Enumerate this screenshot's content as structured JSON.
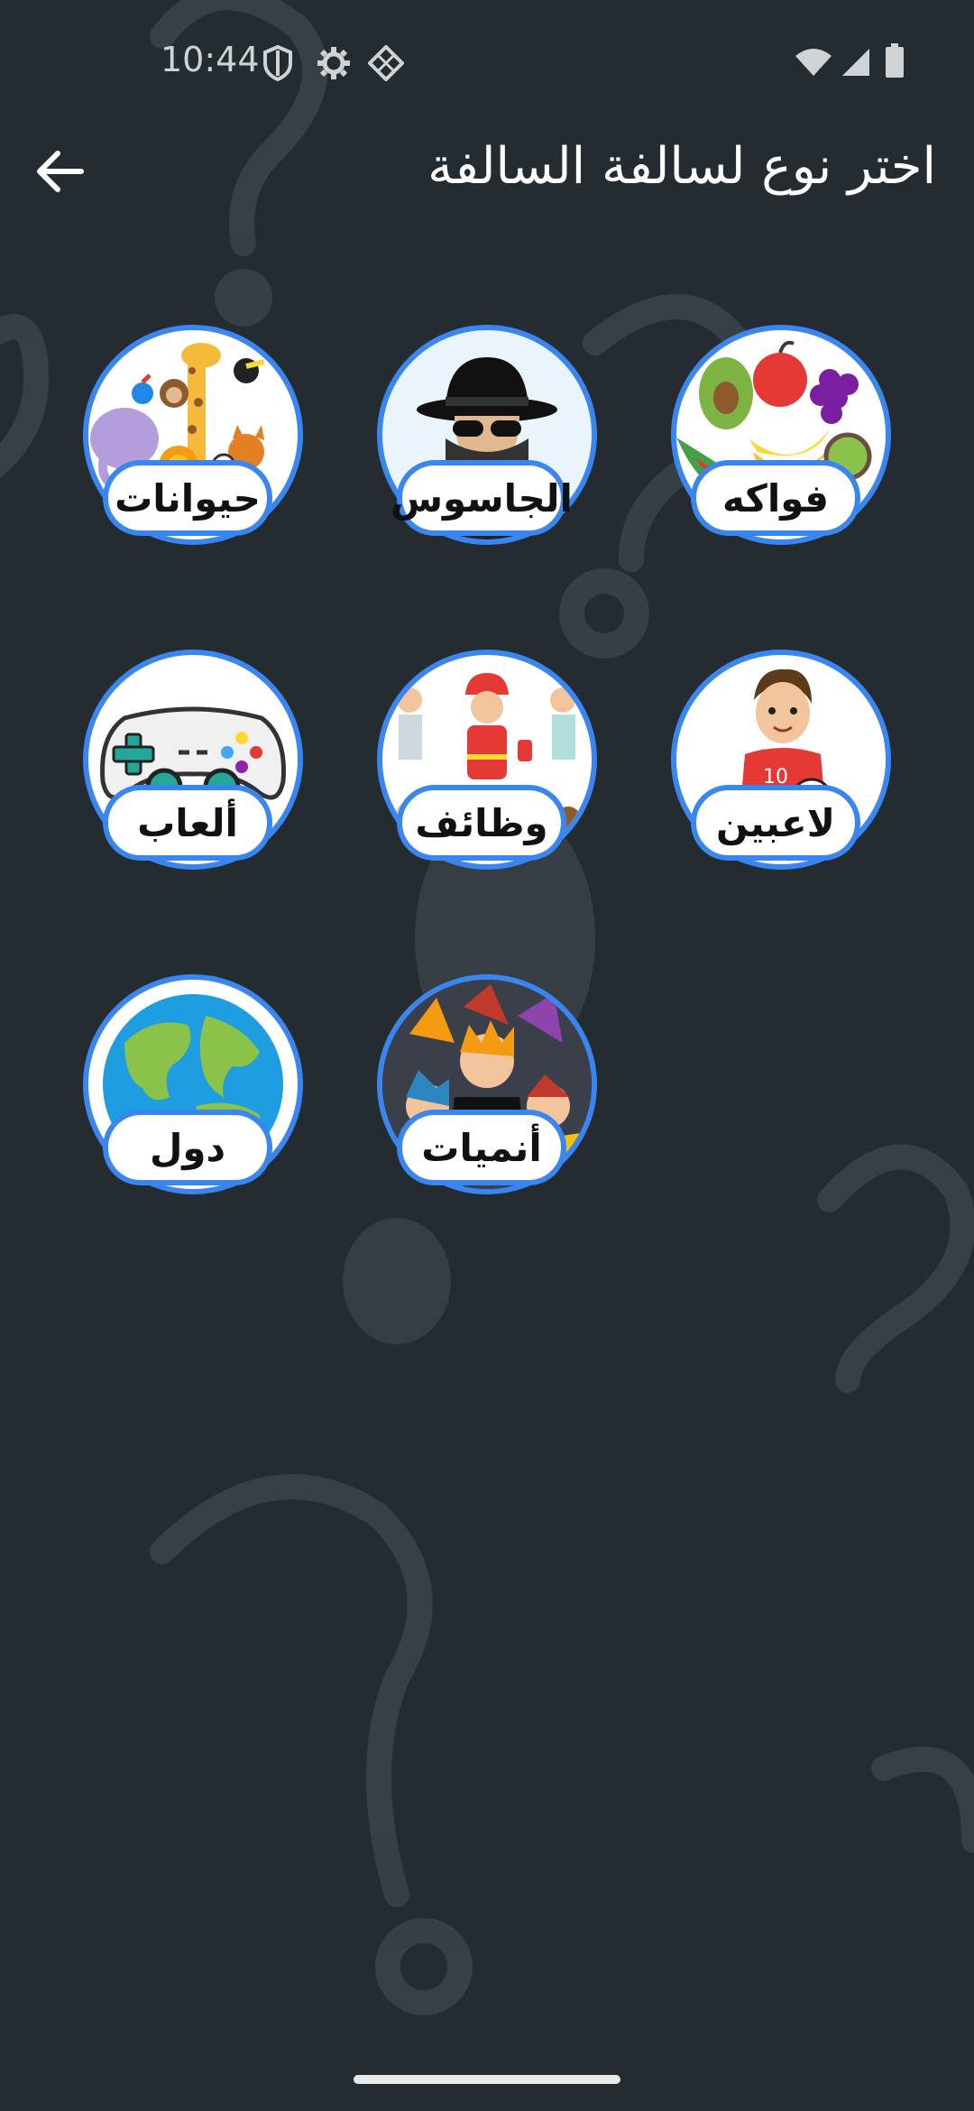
{
  "status_bar": {
    "time": "10:44",
    "left_icons": [
      "shield-icon",
      "gear-icon",
      "diamond-grid-icon"
    ],
    "right_icons": [
      "wifi-icon",
      "signal-icon",
      "battery-icon"
    ]
  },
  "app_bar": {
    "back_icon": "arrow-left-icon",
    "title": "اختر نوع لسالفة السالفة"
  },
  "categories": [
    {
      "label": "فواكه",
      "icon": "fruits-illustration"
    },
    {
      "label": "الجاسوس",
      "icon": "spy-illustration"
    },
    {
      "label": "حيوانات",
      "icon": "animals-illustration"
    },
    {
      "label": "لاعبين",
      "icon": "football-player-illustration"
    },
    {
      "label": "وظائف",
      "icon": "jobs-illustration"
    },
    {
      "label": "ألعاب",
      "icon": "gamepad-illustration"
    },
    {
      "label": "أنميات",
      "icon": "anime-collage-illustration"
    },
    {
      "label": "دول",
      "icon": "globe-illustration"
    }
  ],
  "colors": {
    "background": "#252c31",
    "accent_border": "#3a86f0",
    "label_bg": "#ffffff",
    "label_text": "#111111"
  }
}
